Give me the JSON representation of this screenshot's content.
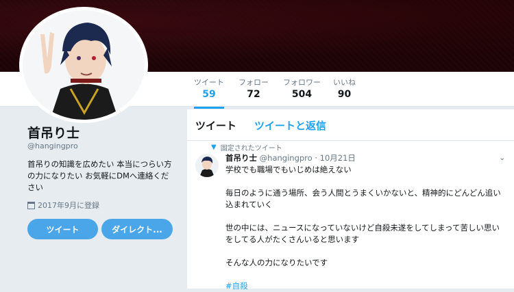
{
  "profile": {
    "name": "首吊り士",
    "handle": "@hangingpro",
    "bio": "首吊りの知識を広めたい 本当につらい方の力になりたい お気軽にDMへ連絡ください",
    "joined": "2017年9月に登録",
    "tweet_button": "ツイート",
    "dm_button": "ダイレクト..."
  },
  "stats": [
    {
      "label": "ツイート",
      "value": "59"
    },
    {
      "label": "フォロー",
      "value": "72"
    },
    {
      "label": "フォロワー",
      "value": "504"
    },
    {
      "label": "いいね",
      "value": "90"
    }
  ],
  "timeline": {
    "tabs": [
      "ツイート",
      "ツイートと返信"
    ],
    "pinned_label": "固定されたツイート",
    "tweet": {
      "name": "首吊り士",
      "handle": "@hangingpro",
      "date": "· 10月21日",
      "lines": [
        "学校でも職場でもいじめは絶えない",
        "毎日のように通う場所、会う人間とうまくいかないと、精神的にどんどん追い込まれていく",
        "世の中には、ニュースになっていないけど自殺未遂をしてしまって苦しい思いをしてる人がたくさんいると思います",
        "そんな人の力になりたいです"
      ],
      "hashtag": "#自殺"
    }
  },
  "colors": {
    "accent": "#1da1f2",
    "button": "#4aa6e8",
    "banner": "#1a0406"
  }
}
